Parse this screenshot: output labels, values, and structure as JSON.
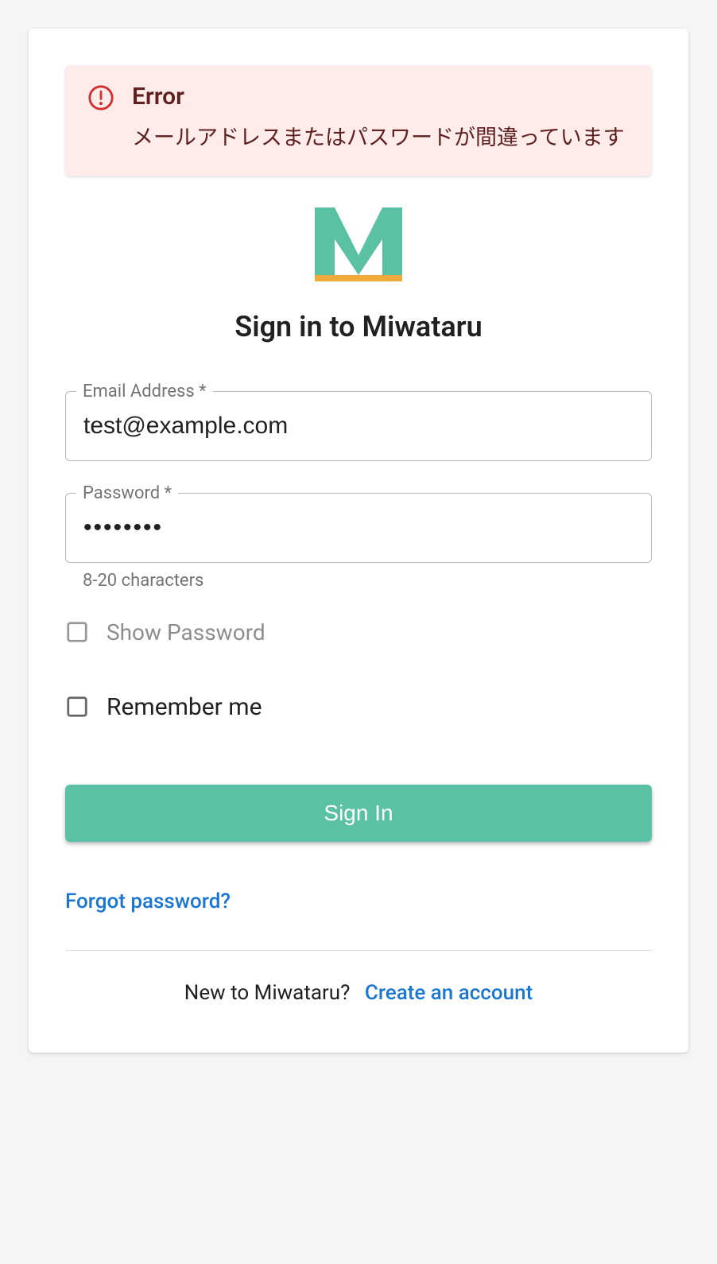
{
  "alert": {
    "title": "Error",
    "message": "メールアドレスまたはパスワードが間違っています"
  },
  "app_name": "Miwataru",
  "heading": "Sign in to Miwataru",
  "fields": {
    "email": {
      "label": "Email Address *",
      "value": "test@example.com"
    },
    "password": {
      "label": "Password *",
      "value": "••••••••",
      "helper": "8-20 characters"
    }
  },
  "checkboxes": {
    "show_password": {
      "label": "Show Password",
      "checked": false
    },
    "remember_me": {
      "label": "Remember me",
      "checked": false
    }
  },
  "buttons": {
    "sign_in": "Sign In"
  },
  "links": {
    "forgot": "Forgot password?",
    "create": "Create an account"
  },
  "footer_prompt": "New to Miwataru?",
  "colors": {
    "primary": "#5ac1a4",
    "link": "#1976d2",
    "error_bg": "#fdecea",
    "error_fg": "#5f2120",
    "error_icon": "#d32f2f",
    "logo_accent": "#f0a93b"
  }
}
